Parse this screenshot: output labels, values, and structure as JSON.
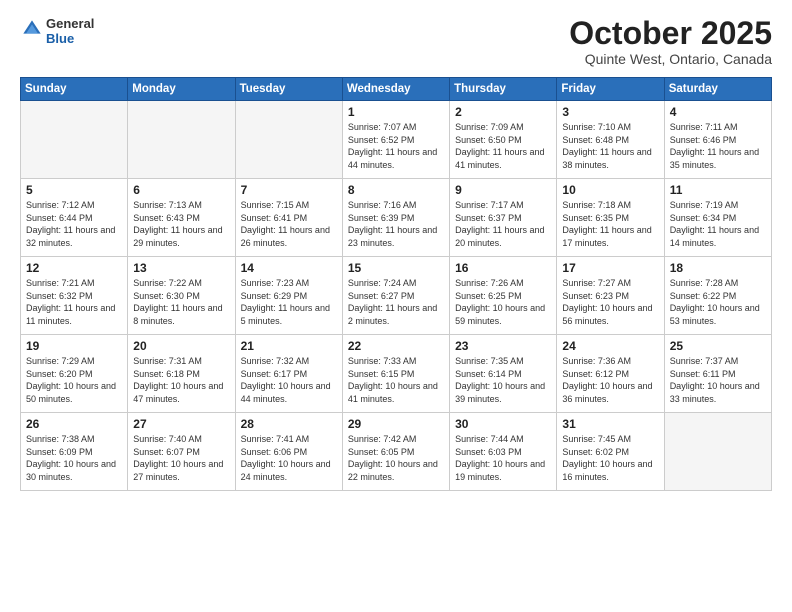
{
  "header": {
    "logo_general": "General",
    "logo_blue": "Blue",
    "month_title": "October 2025",
    "subtitle": "Quinte West, Ontario, Canada"
  },
  "weekdays": [
    "Sunday",
    "Monday",
    "Tuesday",
    "Wednesday",
    "Thursday",
    "Friday",
    "Saturday"
  ],
  "weeks": [
    [
      {
        "day": "",
        "empty": true
      },
      {
        "day": "",
        "empty": true
      },
      {
        "day": "",
        "empty": true
      },
      {
        "day": "1",
        "sunrise": "7:07 AM",
        "sunset": "6:52 PM",
        "daylight": "11 hours and 44 minutes."
      },
      {
        "day": "2",
        "sunrise": "7:09 AM",
        "sunset": "6:50 PM",
        "daylight": "11 hours and 41 minutes."
      },
      {
        "day": "3",
        "sunrise": "7:10 AM",
        "sunset": "6:48 PM",
        "daylight": "11 hours and 38 minutes."
      },
      {
        "day": "4",
        "sunrise": "7:11 AM",
        "sunset": "6:46 PM",
        "daylight": "11 hours and 35 minutes."
      }
    ],
    [
      {
        "day": "5",
        "sunrise": "7:12 AM",
        "sunset": "6:44 PM",
        "daylight": "11 hours and 32 minutes."
      },
      {
        "day": "6",
        "sunrise": "7:13 AM",
        "sunset": "6:43 PM",
        "daylight": "11 hours and 29 minutes."
      },
      {
        "day": "7",
        "sunrise": "7:15 AM",
        "sunset": "6:41 PM",
        "daylight": "11 hours and 26 minutes."
      },
      {
        "day": "8",
        "sunrise": "7:16 AM",
        "sunset": "6:39 PM",
        "daylight": "11 hours and 23 minutes."
      },
      {
        "day": "9",
        "sunrise": "7:17 AM",
        "sunset": "6:37 PM",
        "daylight": "11 hours and 20 minutes."
      },
      {
        "day": "10",
        "sunrise": "7:18 AM",
        "sunset": "6:35 PM",
        "daylight": "11 hours and 17 minutes."
      },
      {
        "day": "11",
        "sunrise": "7:19 AM",
        "sunset": "6:34 PM",
        "daylight": "11 hours and 14 minutes."
      }
    ],
    [
      {
        "day": "12",
        "sunrise": "7:21 AM",
        "sunset": "6:32 PM",
        "daylight": "11 hours and 11 minutes."
      },
      {
        "day": "13",
        "sunrise": "7:22 AM",
        "sunset": "6:30 PM",
        "daylight": "11 hours and 8 minutes."
      },
      {
        "day": "14",
        "sunrise": "7:23 AM",
        "sunset": "6:29 PM",
        "daylight": "11 hours and 5 minutes."
      },
      {
        "day": "15",
        "sunrise": "7:24 AM",
        "sunset": "6:27 PM",
        "daylight": "11 hours and 2 minutes."
      },
      {
        "day": "16",
        "sunrise": "7:26 AM",
        "sunset": "6:25 PM",
        "daylight": "10 hours and 59 minutes."
      },
      {
        "day": "17",
        "sunrise": "7:27 AM",
        "sunset": "6:23 PM",
        "daylight": "10 hours and 56 minutes."
      },
      {
        "day": "18",
        "sunrise": "7:28 AM",
        "sunset": "6:22 PM",
        "daylight": "10 hours and 53 minutes."
      }
    ],
    [
      {
        "day": "19",
        "sunrise": "7:29 AM",
        "sunset": "6:20 PM",
        "daylight": "10 hours and 50 minutes."
      },
      {
        "day": "20",
        "sunrise": "7:31 AM",
        "sunset": "6:18 PM",
        "daylight": "10 hours and 47 minutes."
      },
      {
        "day": "21",
        "sunrise": "7:32 AM",
        "sunset": "6:17 PM",
        "daylight": "10 hours and 44 minutes."
      },
      {
        "day": "22",
        "sunrise": "7:33 AM",
        "sunset": "6:15 PM",
        "daylight": "10 hours and 41 minutes."
      },
      {
        "day": "23",
        "sunrise": "7:35 AM",
        "sunset": "6:14 PM",
        "daylight": "10 hours and 39 minutes."
      },
      {
        "day": "24",
        "sunrise": "7:36 AM",
        "sunset": "6:12 PM",
        "daylight": "10 hours and 36 minutes."
      },
      {
        "day": "25",
        "sunrise": "7:37 AM",
        "sunset": "6:11 PM",
        "daylight": "10 hours and 33 minutes."
      }
    ],
    [
      {
        "day": "26",
        "sunrise": "7:38 AM",
        "sunset": "6:09 PM",
        "daylight": "10 hours and 30 minutes."
      },
      {
        "day": "27",
        "sunrise": "7:40 AM",
        "sunset": "6:07 PM",
        "daylight": "10 hours and 27 minutes."
      },
      {
        "day": "28",
        "sunrise": "7:41 AM",
        "sunset": "6:06 PM",
        "daylight": "10 hours and 24 minutes."
      },
      {
        "day": "29",
        "sunrise": "7:42 AM",
        "sunset": "6:05 PM",
        "daylight": "10 hours and 22 minutes."
      },
      {
        "day": "30",
        "sunrise": "7:44 AM",
        "sunset": "6:03 PM",
        "daylight": "10 hours and 19 minutes."
      },
      {
        "day": "31",
        "sunrise": "7:45 AM",
        "sunset": "6:02 PM",
        "daylight": "10 hours and 16 minutes."
      },
      {
        "day": "",
        "empty": true
      }
    ]
  ],
  "labels": {
    "sunrise": "Sunrise:",
    "sunset": "Sunset:",
    "daylight": "Daylight:"
  }
}
